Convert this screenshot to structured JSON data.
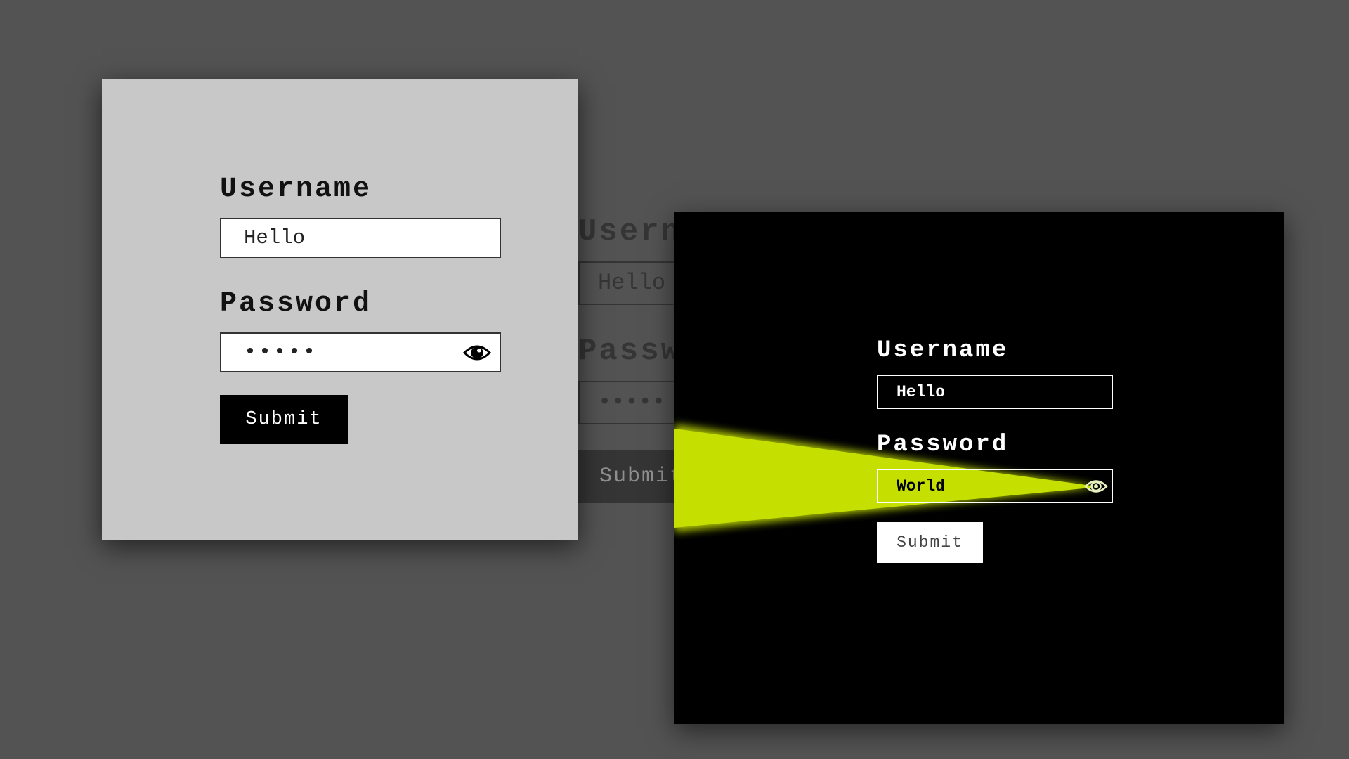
{
  "colors": {
    "background": "#535353",
    "light_card": "#c8c8c8",
    "dark_card": "#000000",
    "beam": "#c5e000"
  },
  "ghost_form": {
    "username_label": "Username",
    "username_value": "Hello",
    "password_label": "Password",
    "password_value": "•••••",
    "submit_label": "Submit"
  },
  "light_form": {
    "username_label": "Username",
    "username_value": "Hello",
    "password_label": "Password",
    "password_value": "•••••",
    "password_toggle_icon": "eye-icon",
    "submit_label": "Submit"
  },
  "dark_form": {
    "username_label": "Username",
    "username_value": "Hello",
    "password_label": "Password",
    "password_value": "World",
    "password_toggle_icon": "eye-icon",
    "submit_label": "Submit"
  }
}
